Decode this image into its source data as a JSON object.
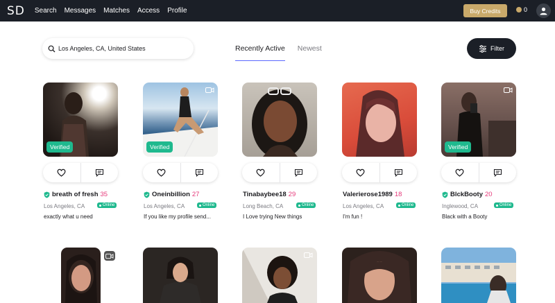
{
  "header": {
    "logo": "SD",
    "nav": [
      "Search",
      "Messages",
      "Matches",
      "Access",
      "Profile"
    ],
    "buy_credits": "Buy Credits",
    "credits": "0"
  },
  "search": {
    "value": "Los Angeles, CA, United States"
  },
  "tabs": [
    "Recently Active",
    "Newest"
  ],
  "filter_label": "Filter",
  "verified_label": "Verified",
  "online_label": "Online",
  "profiles": [
    {
      "username": "breath of fresh",
      "age": "35",
      "location": "Los Angeles, CA",
      "bio": "exactly what u need",
      "verified": true,
      "video": false
    },
    {
      "username": "Oneinbillion",
      "age": "27",
      "location": "Los Angeles, CA",
      "bio": "If you like my profile send...",
      "verified": true,
      "video": true
    },
    {
      "username": "Tinabaybee18",
      "age": "29",
      "location": "Long Beach, CA",
      "bio": "I Love trying New things",
      "verified": false,
      "video": false
    },
    {
      "username": "Valerierose1989",
      "age": "18",
      "location": "Los Angeles, CA",
      "bio": "I'm fun !",
      "verified": false,
      "video": false
    },
    {
      "username": "BlckBooty",
      "age": "20",
      "location": "Inglewood, CA",
      "bio": "Black with a Booty",
      "verified": true,
      "video": true
    }
  ],
  "colors": {
    "nav_bg": "#1b1f27",
    "gold": "#c9a96a",
    "green": "#1fb98e",
    "pink": "#e6397a",
    "accent": "#5a68ff"
  }
}
